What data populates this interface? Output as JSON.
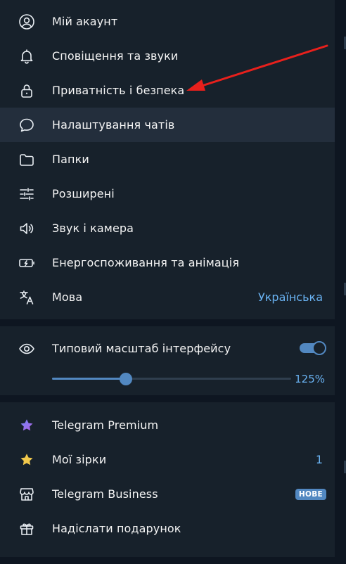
{
  "menu": [
    {
      "label": "Мій акаунт",
      "icon": "account-circle-icon"
    },
    {
      "label": "Сповіщення та звуки",
      "icon": "bell-icon"
    },
    {
      "label": "Приватність і безпека",
      "icon": "lock-icon"
    },
    {
      "label": "Налаштування чатів",
      "icon": "chat-bubble-icon"
    },
    {
      "label": "Папки",
      "icon": "folder-icon"
    },
    {
      "label": "Розширені",
      "icon": "sliders-icon"
    },
    {
      "label": "Звук і камера",
      "icon": "speaker-icon"
    },
    {
      "label": "Енергоспоживання та анімація",
      "icon": "battery-icon"
    },
    {
      "label": "Мова",
      "icon": "translate-icon",
      "value": "Українська"
    }
  ],
  "active_item": "Налаштування чатів",
  "scale": {
    "label": "Типовий масштаб інтерфейсу",
    "icon": "eye-icon",
    "toggle_on": true,
    "value": "125%",
    "slider_fraction": 0.31
  },
  "extras": [
    {
      "label": "Telegram Premium",
      "icon": "premium-star-icon"
    },
    {
      "label": "Мої зірки",
      "icon": "gold-star-icon",
      "value": "1"
    },
    {
      "label": "Telegram Business",
      "icon": "shop-icon",
      "badge": "НОВЕ"
    },
    {
      "label": "Надіслати подарунок",
      "icon": "gift-icon"
    }
  ],
  "colors": {
    "background": "#17212b",
    "separator": "#0e1621",
    "active_row": "#232e3c",
    "accent": "#5288c1",
    "link": "#6ab3f3",
    "annotation_arrow": "#e8201c",
    "premium_star": "#8b68f0",
    "gold_star": "#f2c94c"
  }
}
